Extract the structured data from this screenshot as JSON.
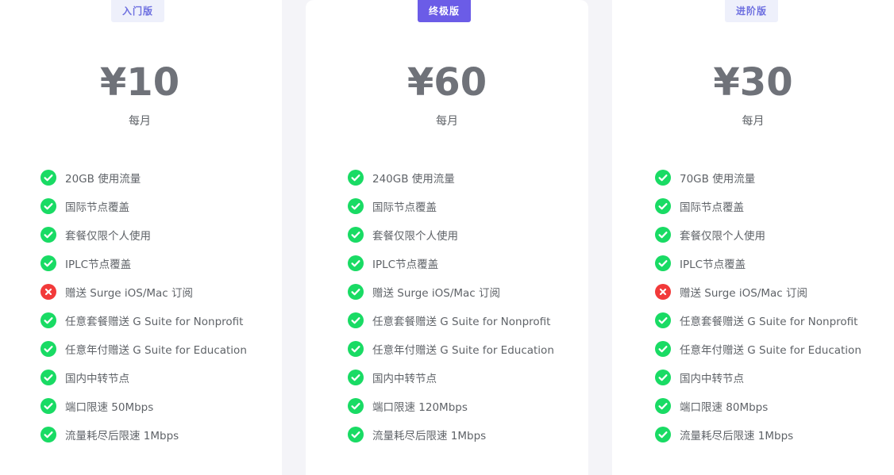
{
  "cards": [
    {
      "badge": "入门版",
      "price": "¥10",
      "period": "每月",
      "features": [
        {
          "text": "20GB 使用流量",
          "included": true
        },
        {
          "text": "国际节点覆盖",
          "included": true
        },
        {
          "text": "套餐仅限个人使用",
          "included": true
        },
        {
          "text": "IPLC节点覆盖",
          "included": true
        },
        {
          "text": "赠送 Surge iOS/Mac 订阅",
          "included": false
        },
        {
          "text": "任意套餐赠送 G Suite for Nonprofit",
          "included": true
        },
        {
          "text": "任意年付赠送 G Suite for Education",
          "included": true
        },
        {
          "text": "国内中转节点",
          "included": true
        },
        {
          "text": "端口限速 50Mbps",
          "included": true
        },
        {
          "text": "流量耗尽后限速 1Mbps",
          "included": true
        }
      ]
    },
    {
      "badge": "终极版",
      "price": "¥60",
      "period": "每月",
      "features": [
        {
          "text": "240GB 使用流量",
          "included": true
        },
        {
          "text": "国际节点覆盖",
          "included": true
        },
        {
          "text": "套餐仅限个人使用",
          "included": true
        },
        {
          "text": "IPLC节点覆盖",
          "included": true
        },
        {
          "text": "赠送 Surge iOS/Mac 订阅",
          "included": true
        },
        {
          "text": "任意套餐赠送 G Suite for Nonprofit",
          "included": true
        },
        {
          "text": "任意年付赠送 G Suite for Education",
          "included": true
        },
        {
          "text": "国内中转节点",
          "included": true
        },
        {
          "text": "端口限速 120Mbps",
          "included": true
        },
        {
          "text": "流量耗尽后限速 1Mbps",
          "included": true
        }
      ]
    },
    {
      "badge": "进阶版",
      "price": "¥30",
      "period": "每月",
      "features": [
        {
          "text": "70GB 使用流量",
          "included": true
        },
        {
          "text": "国际节点覆盖",
          "included": true
        },
        {
          "text": "套餐仅限个人使用",
          "included": true
        },
        {
          "text": "IPLC节点覆盖",
          "included": true
        },
        {
          "text": "赠送 Surge iOS/Mac 订阅",
          "included": false
        },
        {
          "text": "任意套餐赠送 G Suite for Nonprofit",
          "included": true
        },
        {
          "text": "任意年付赠送 G Suite for Education",
          "included": true
        },
        {
          "text": "国内中转节点",
          "included": true
        },
        {
          "text": "端口限速 80Mbps",
          "included": true
        },
        {
          "text": "流量耗尽后限速 1Mbps",
          "included": true
        }
      ]
    }
  ],
  "icons": {
    "included": "check-circle-icon",
    "excluded": "x-circle-icon"
  },
  "colors": {
    "accent": "#6b5ce7",
    "badge_light_bg": "#eef0fb",
    "badge_light_text": "#6d6fe0",
    "check_green": "#19db64",
    "cross_red": "#f23a3a",
    "price_text": "#6f7279",
    "body_text": "#5f6368",
    "page_bg": "#f4f4f8"
  }
}
